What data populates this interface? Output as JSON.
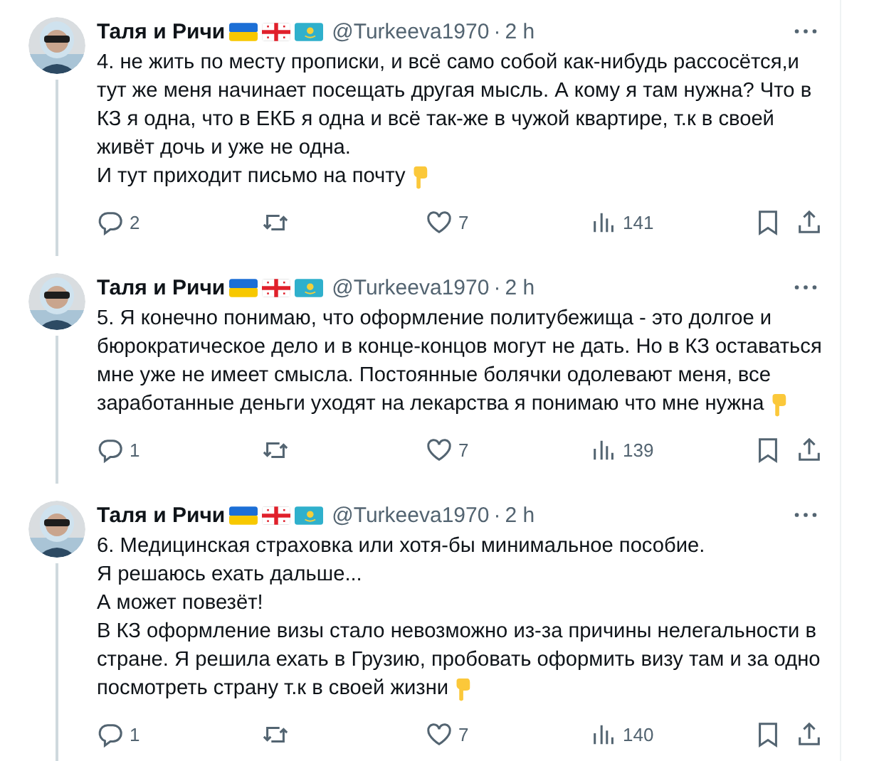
{
  "tweets": [
    {
      "author": "Таля и Ричи",
      "handle": "@Turkeeva1970",
      "separator": "·",
      "time": "2 h",
      "lines": [
        "4. не жить по месту прописки, и всё само собой как-нибудь рассосётся,и",
        "тут же меня начинает посещать другая мысль. А кому я там нужна? Что в",
        "КЗ я одна, что в ЕКБ я одна и всё так-же в чужой квартире, т.к в своей",
        "живёт дочь и уже  не одна.",
        "И тут приходит письмо на почту"
      ],
      "replies": "2",
      "likes": "7",
      "views": "141"
    },
    {
      "author": "Таля и Ричи",
      "handle": "@Turkeeva1970",
      "separator": "·",
      "time": "2 h",
      "lines": [
        "5. Я конечно понимаю, что оформление политубежища - это долгое и",
        "бюрократическое дело и в конце-концов могут не дать. Но в КЗ оставаться",
        "мне уже не имеет смысла. Постоянные болячки одолевают меня, все",
        "заработанные деньги уходят на лекарства я понимаю что мне нужна"
      ],
      "replies": "1",
      "likes": "7",
      "views": "139"
    },
    {
      "author": "Таля и Ричи",
      "handle": "@Turkeeva1970",
      "separator": "·",
      "time": "2 h",
      "lines": [
        "6. Медицинская страховка или хотя-бы минимальное пособие.",
        "Я решаюсь ехать дальше...",
        "А может повезёт!",
        "В КЗ оформление визы стало невозможно из-за причины нелегальности в",
        "стране. Я решила ехать в Грузию,  пробовать оформить визу там и за одно",
        "посмотреть страну т.к в своей жизни"
      ],
      "replies": "1",
      "likes": "7",
      "views": "140"
    }
  ]
}
